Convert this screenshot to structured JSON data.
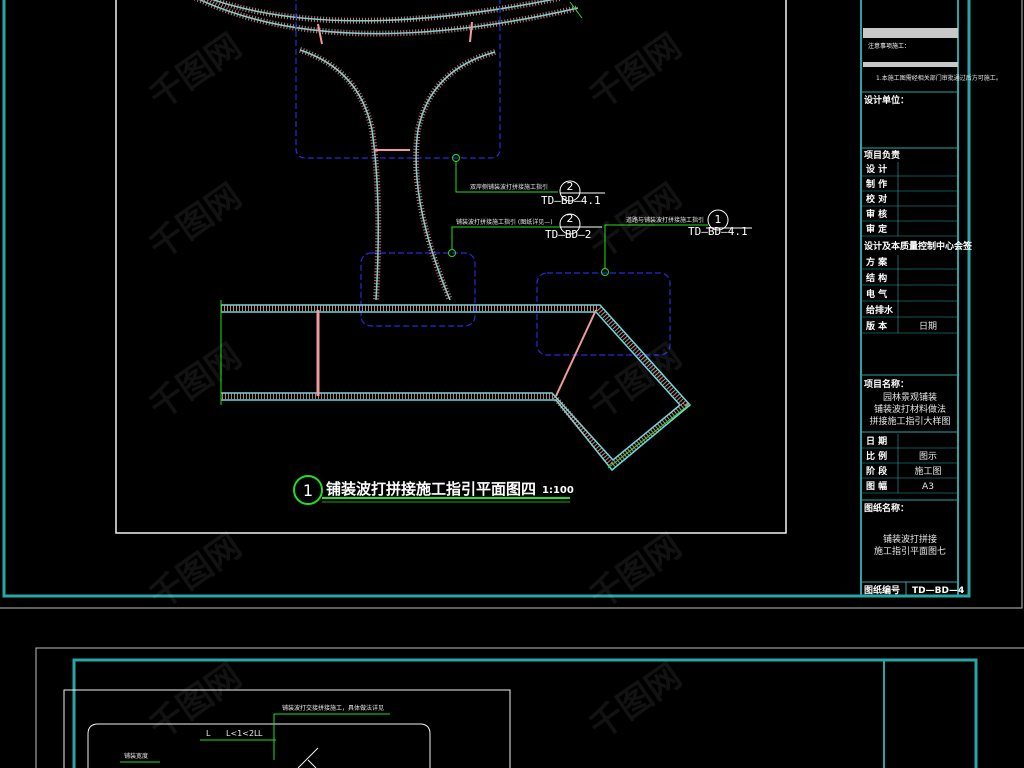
{
  "colors": {
    "frame": "#2aa5a5",
    "sheet": "#f2f2f2",
    "paving": "#f09a9a",
    "paving_edge": "#60e0e0",
    "dashed_zone": "#2a2ad8",
    "leader": "#20e020",
    "title_circle": "#20e020"
  },
  "drawing": {
    "title": "铺装波打拼接施工指引平面图四",
    "title_number": "1",
    "scale": "1:100",
    "callouts": [
      {
        "label": "双岸侧铺装波打拼接施工指引",
        "number": "2",
        "ref": "TD—BD—4.1"
      },
      {
        "label": "铺装波打拼接施工指引 (图纸详见—)",
        "number": "2",
        "ref": "TD—BD—2"
      },
      {
        "label": "道路与铺装波打拼接施工指引",
        "number": "1",
        "ref": "TD—BD—4.1"
      }
    ],
    "lower_labels": [
      "铺装波打交接拼接施工，具体做法详见",
      "铺装宽度"
    ],
    "dims": [
      "L",
      "L<1<2L",
      "L"
    ]
  },
  "title_block": {
    "note_heading": "注意事项施工：",
    "note_line": "1.本施工图需经相关部门审批通过后方可施工。",
    "design_note": "设计单位：",
    "project_owner": "项目负责",
    "rows_1": [
      {
        "label": "设 计",
        "value": ""
      },
      {
        "label": "制 作",
        "value": ""
      },
      {
        "label": "校 对",
        "value": ""
      },
      {
        "label": "审 核",
        "value": ""
      },
      {
        "label": "审 定",
        "value": ""
      }
    ],
    "section_2": "设计及本质量控制中心会签",
    "rows_2": [
      {
        "label": "方 案",
        "value": ""
      },
      {
        "label": "结 构",
        "value": ""
      },
      {
        "label": "电 气",
        "value": ""
      },
      {
        "label": "给排水",
        "value": ""
      },
      {
        "label": "版 本",
        "value": "日期"
      }
    ],
    "project_name_label": "项目名称：",
    "project_name": [
      "园林景观铺装",
      "铺装波打材料做法",
      "拼接施工指引大样图"
    ],
    "rows_3": [
      {
        "label": "日 期",
        "value": ""
      },
      {
        "label": "比 例",
        "value": "图示"
      },
      {
        "label": "阶 段",
        "value": "施工图"
      },
      {
        "label": "图 幅",
        "value": "A3"
      }
    ],
    "drawing_name_label": "图纸名称：",
    "drawing_name": [
      "铺装波打拼接",
      "施工指引平面图七"
    ],
    "drawing_no_label": "图纸编号",
    "drawing_no": "TD—BD—4"
  },
  "watermark": "千图网"
}
